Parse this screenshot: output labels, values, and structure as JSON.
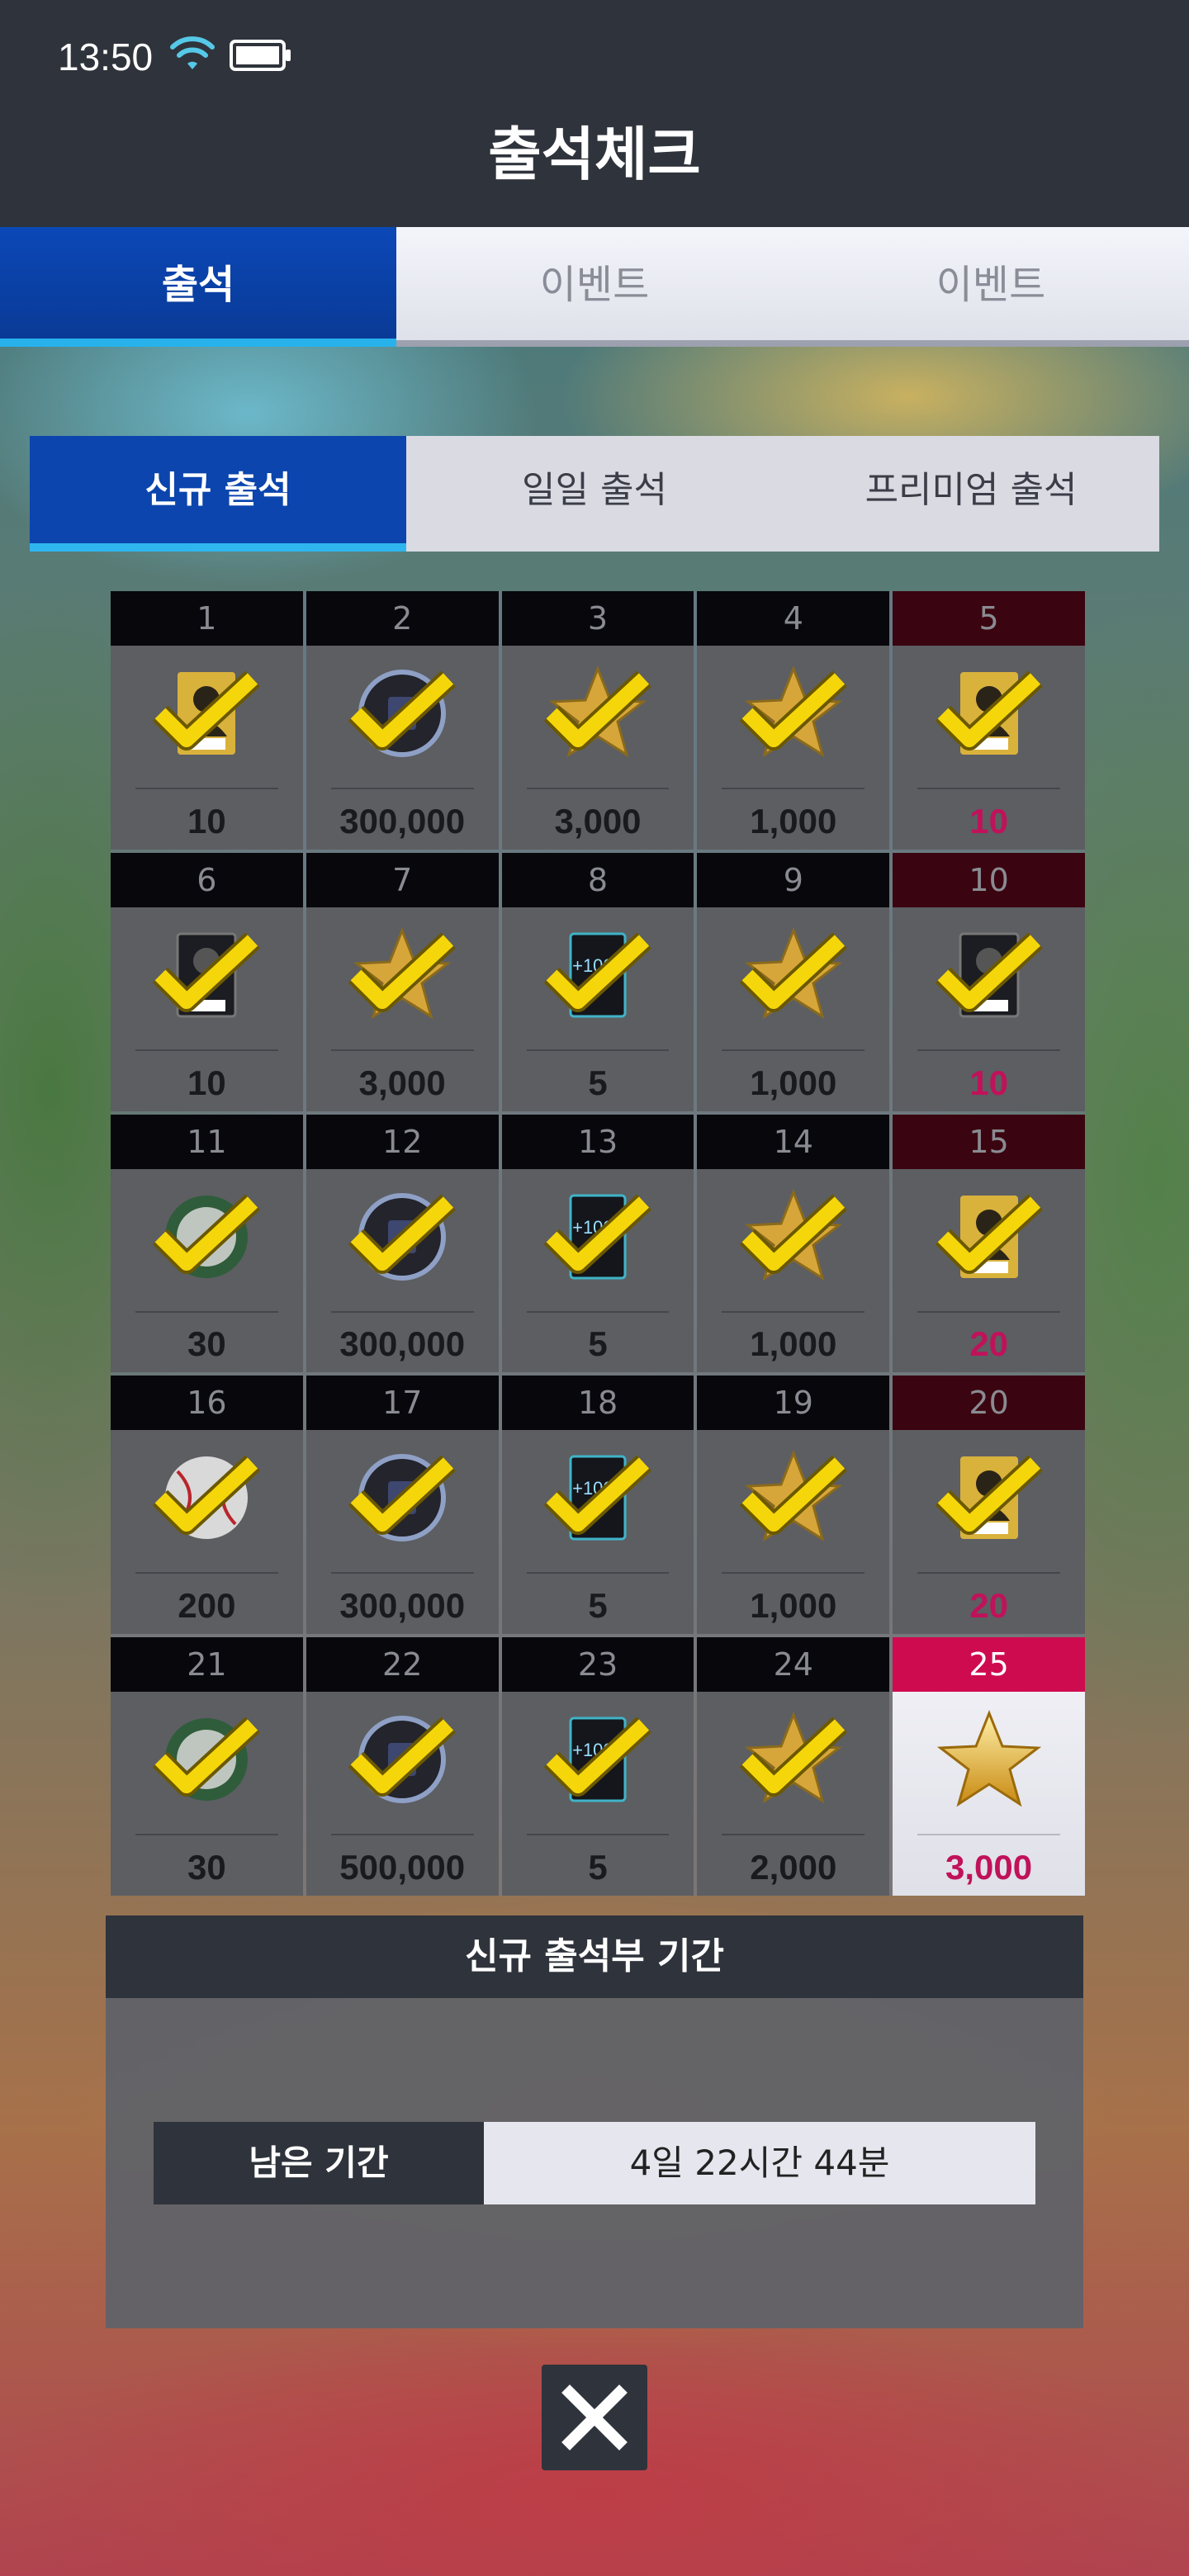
{
  "status_bar": {
    "time": "13:50"
  },
  "header": {
    "title": "출석체크"
  },
  "tabs": [
    {
      "label": "출석",
      "active": true
    },
    {
      "label": "이벤트",
      "active": false
    },
    {
      "label": "이벤트",
      "active": false
    }
  ],
  "subtabs": [
    {
      "label": "신규 출석",
      "active": true
    },
    {
      "label": "일일 출석",
      "active": false
    },
    {
      "label": "프리미엄 출석",
      "active": false
    }
  ],
  "days": [
    {
      "day": "1",
      "reward": "player-card",
      "amount": "10",
      "claimed": true
    },
    {
      "day": "2",
      "reward": "coin",
      "amount": "300,000",
      "claimed": true
    },
    {
      "day": "3",
      "reward": "star",
      "amount": "3,000",
      "claimed": true
    },
    {
      "day": "4",
      "reward": "star",
      "amount": "1,000",
      "claimed": true
    },
    {
      "day": "5",
      "reward": "player-card",
      "amount": "10",
      "claimed": true,
      "highlight": true
    },
    {
      "day": "6",
      "reward": "player-card-dark",
      "amount": "10",
      "claimed": true
    },
    {
      "day": "7",
      "reward": "star",
      "amount": "3,000",
      "claimed": true
    },
    {
      "day": "8",
      "reward": "exp-card",
      "amount": "5",
      "claimed": true
    },
    {
      "day": "9",
      "reward": "star",
      "amount": "1,000",
      "claimed": true
    },
    {
      "day": "10",
      "reward": "player-card-dark",
      "amount": "10",
      "claimed": true,
      "highlight": true
    },
    {
      "day": "11",
      "reward": "green-ball",
      "amount": "30",
      "claimed": true
    },
    {
      "day": "12",
      "reward": "coin",
      "amount": "300,000",
      "claimed": true
    },
    {
      "day": "13",
      "reward": "exp-card",
      "amount": "5",
      "claimed": true
    },
    {
      "day": "14",
      "reward": "star",
      "amount": "1,000",
      "claimed": true
    },
    {
      "day": "15",
      "reward": "player-card",
      "amount": "20",
      "claimed": true,
      "highlight": true
    },
    {
      "day": "16",
      "reward": "baseball",
      "amount": "200",
      "claimed": true
    },
    {
      "day": "17",
      "reward": "coin",
      "amount": "300,000",
      "claimed": true
    },
    {
      "day": "18",
      "reward": "exp-card",
      "amount": "5",
      "claimed": true
    },
    {
      "day": "19",
      "reward": "star",
      "amount": "1,000",
      "claimed": true
    },
    {
      "day": "20",
      "reward": "player-card",
      "amount": "20",
      "claimed": true,
      "highlight": true
    },
    {
      "day": "21",
      "reward": "green-ball",
      "amount": "30",
      "claimed": true
    },
    {
      "day": "22",
      "reward": "coin",
      "amount": "500,000",
      "claimed": true
    },
    {
      "day": "23",
      "reward": "exp-card",
      "amount": "5",
      "claimed": true
    },
    {
      "day": "24",
      "reward": "star",
      "amount": "2,000",
      "claimed": true
    },
    {
      "day": "25",
      "reward": "star",
      "amount": "3,000",
      "claimed": false,
      "highlight": true,
      "final": true
    }
  ],
  "period": {
    "title": "신규 출석부 기간",
    "label": "남은 기간",
    "value": "4일 22시간 44분"
  },
  "colors": {
    "active_tab": "#0b48b7",
    "accent_underline": "#27b2ec",
    "highlight_amount": "#c0125a",
    "check": "#f5d60a"
  }
}
